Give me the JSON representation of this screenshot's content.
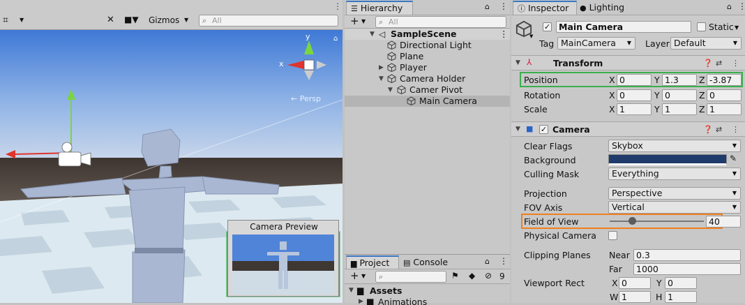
{
  "scene_toolbar": {
    "gizmos_label": "Gizmos",
    "search_placeholder": "All"
  },
  "scene_view": {
    "persp_label": "← Persp",
    "axis_x_label": "x",
    "axis_y_label": "y",
    "camera_preview_title": "Camera Preview"
  },
  "hierarchy": {
    "tab_label": "Hierarchy",
    "search_placeholder": "All",
    "items": [
      {
        "label": "SampleScene"
      },
      {
        "label": "Directional Light"
      },
      {
        "label": "Plane"
      },
      {
        "label": "Player"
      },
      {
        "label": "Camera Holder"
      },
      {
        "label": "Camer Pivot"
      },
      {
        "label": "Main Camera"
      }
    ]
  },
  "project": {
    "project_tab": "Project",
    "console_tab": "Console",
    "hidden_count": "9",
    "assets_label": "Assets",
    "animations_label": "Animations"
  },
  "inspector": {
    "inspector_tab": "Inspector",
    "lighting_tab": "Lighting",
    "object_name": "Main Camera",
    "static_label": "Static",
    "tag_label": "Tag",
    "tag_value": "MainCamera",
    "layer_label": "Layer",
    "layer_value": "Default",
    "transform": {
      "title": "Transform",
      "position_label": "Position",
      "rotation_label": "Rotation",
      "scale_label": "Scale",
      "x": "X",
      "y": "Y",
      "z": "Z",
      "position": {
        "x": "0",
        "y": "1.3",
        "z": "-3.87"
      },
      "rotation": {
        "x": "0",
        "y": "0",
        "z": "0"
      },
      "scale": {
        "x": "1",
        "y": "1",
        "z": "1"
      }
    },
    "camera": {
      "title": "Camera",
      "clear_flags_label": "Clear Flags",
      "clear_flags_value": "Skybox",
      "background_label": "Background",
      "background_color": "#1f3b6b",
      "culling_mask_label": "Culling Mask",
      "culling_mask_value": "Everything",
      "projection_label": "Projection",
      "projection_value": "Perspective",
      "fov_axis_label": "FOV Axis",
      "fov_axis_value": "Vertical",
      "fov_label": "Field of View",
      "fov_value": "40",
      "fov_slider_fraction": 0.22,
      "physical_camera_label": "Physical Camera",
      "clipping_label": "Clipping Planes",
      "near_label": "Near",
      "near_value": "0.3",
      "far_label": "Far",
      "far_value": "1000",
      "viewport_label": "Viewport Rect",
      "vp_x_label": "X",
      "vp_x": "0",
      "vp_y_label": "Y",
      "vp_y": "0",
      "vp_w_label": "W",
      "vp_w": "1",
      "vp_h_label": "H",
      "vp_h": "1"
    }
  },
  "colors": {
    "highlight_green": "#3cae4c",
    "highlight_orange": "#f07f1e",
    "tab_accent": "#3a78c2"
  }
}
